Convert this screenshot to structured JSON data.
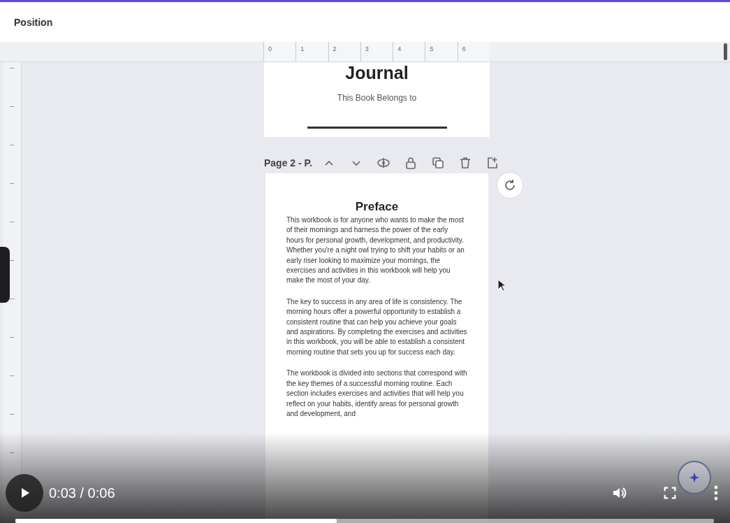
{
  "editor": {
    "header": {
      "title": "Position"
    },
    "ruler": {
      "marks": [
        "0",
        "1",
        "2",
        "3",
        "4",
        "5",
        "6"
      ]
    },
    "pages": [
      {
        "kind": "cover",
        "title": "Journal",
        "subtitle": "This Book Belongs to"
      },
      {
        "kind": "text",
        "title": "Preface",
        "paragraphs": [
          "This workbook is for anyone who wants to make the most of their mornings and harness the power of the early hours for personal growth, development, and productivity. Whether you're a night owl trying to shift your habits or an early riser looking to maximize your mornings, the exercises and activities in this workbook will help you make the most of your day.",
          "The key to success in any area of life is consistency. The morning hours offer a powerful opportunity to establish a consistent routine that can help you achieve your goals and aspirations. By completing the exercises and activities in this workbook, you will be able to establish a consistent morning routine that sets you up for success each day.",
          "The workbook is divided into sections that correspond with the key themes of a successful morning routine. Each section includes exercises and activities that will help you reflect on your habits, identify areas for personal growth and development, and"
        ]
      }
    ],
    "page_toolbar": {
      "label": "Page 2 - P."
    }
  },
  "player": {
    "time": "0:03 / 0:06",
    "progress": {
      "level": 0.46
    }
  }
}
